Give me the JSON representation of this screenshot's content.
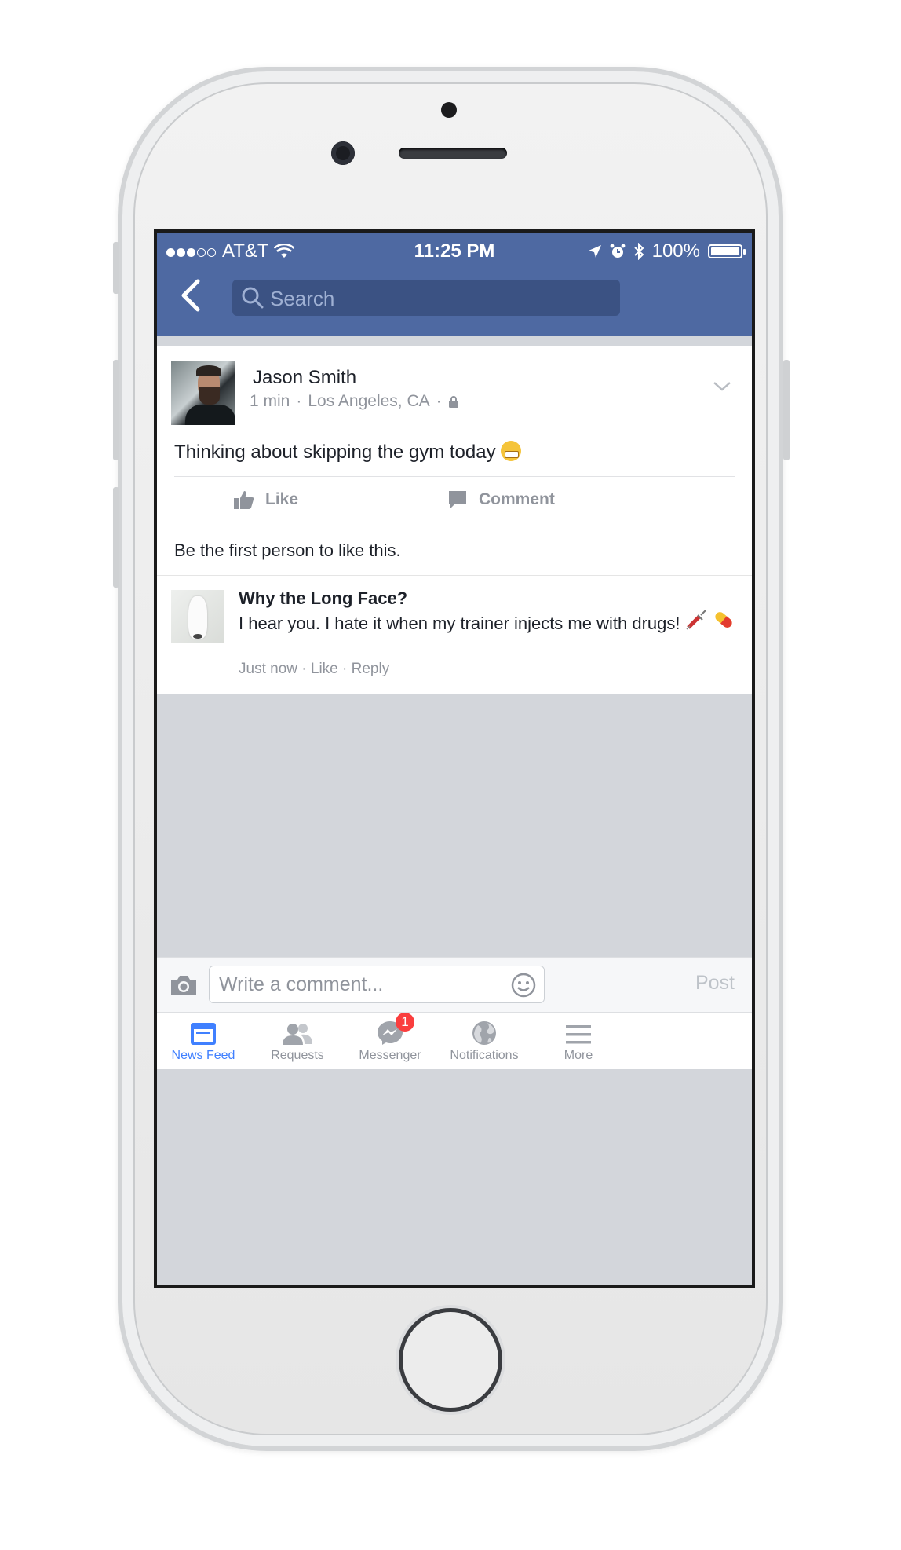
{
  "status_bar": {
    "carrier": "AT&T",
    "time": "11:25 PM",
    "battery": "100%"
  },
  "nav": {
    "search_placeholder": "Search"
  },
  "post": {
    "author": "Jason Smith",
    "time": "1 min",
    "location": "Los Angeles, CA",
    "text": "Thinking about skipping the gym today",
    "like_label": "Like",
    "comment_label": "Comment",
    "likes_summary": "Be the first person to like this."
  },
  "comment": {
    "author": "Why the Long Face?",
    "text": "I hear you. I hate it when my trainer injects me with drugs!",
    "time": "Just now",
    "like_label": "Like",
    "reply_label": "Reply"
  },
  "composer": {
    "placeholder": "Write a comment...",
    "post_label": "Post"
  },
  "tabbar": {
    "items": [
      {
        "label": "News Feed",
        "icon": "news-feed-icon",
        "active": true
      },
      {
        "label": "Requests",
        "icon": "friend-requests-icon"
      },
      {
        "label": "Messenger",
        "icon": "messenger-icon",
        "badge": "1"
      },
      {
        "label": "Notifications",
        "icon": "globe-icon"
      },
      {
        "label": "More",
        "icon": "hamburger-menu-icon"
      }
    ]
  },
  "colors": {
    "brand_blue": "#4e69a2",
    "active_tab": "#4080ff",
    "badge_red": "#fa3e3e"
  }
}
